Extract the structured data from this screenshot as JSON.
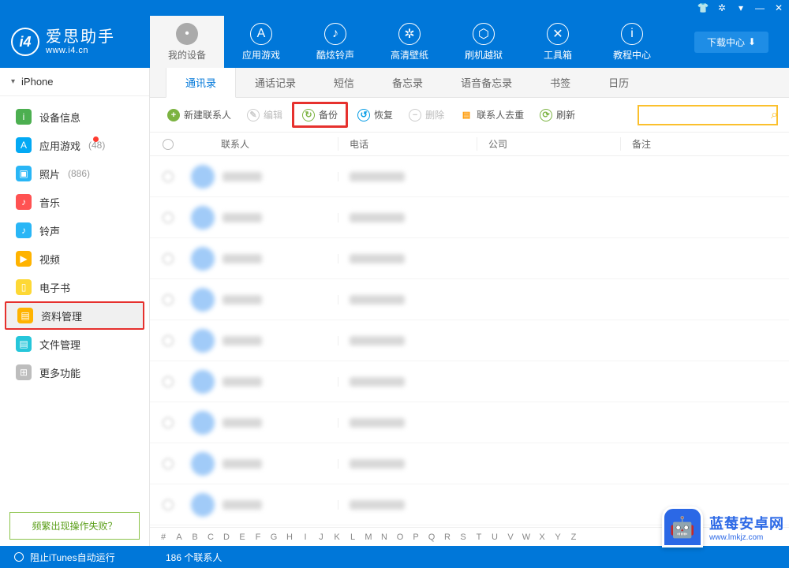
{
  "titlebar": {
    "icons": [
      "shirt",
      "gear",
      "dropdown",
      "min",
      "close"
    ]
  },
  "logo": {
    "badge": "i4",
    "cn": "爱思助手",
    "en": "www.i4.cn"
  },
  "nav": [
    {
      "label": "我的设备",
      "icon": "apple",
      "active": true
    },
    {
      "label": "应用游戏",
      "icon": "app"
    },
    {
      "label": "酷炫铃声",
      "icon": "bell"
    },
    {
      "label": "高清壁纸",
      "icon": "wall"
    },
    {
      "label": "刷机越狱",
      "icon": "box"
    },
    {
      "label": "工具箱",
      "icon": "tool"
    },
    {
      "label": "教程中心",
      "icon": "info"
    }
  ],
  "download_btn": "下载中心",
  "device_name": "iPhone",
  "sidebar": [
    {
      "label": "设备信息",
      "color": "#4caf50",
      "glyph": "i"
    },
    {
      "label": "应用游戏",
      "color": "#03a9f4",
      "glyph": "A",
      "count": "(48)",
      "dot": true
    },
    {
      "label": "照片",
      "color": "#29b6f6",
      "glyph": "▣",
      "count": "(886)"
    },
    {
      "label": "音乐",
      "color": "#ff5252",
      "glyph": "♪"
    },
    {
      "label": "铃声",
      "color": "#29b6f6",
      "glyph": "♪"
    },
    {
      "label": "视频",
      "color": "#ffb300",
      "glyph": "▶"
    },
    {
      "label": "电子书",
      "color": "#fdd835",
      "glyph": "▯"
    },
    {
      "label": "资料管理",
      "color": "#ffb300",
      "glyph": "▤",
      "highlighted": true
    },
    {
      "label": "文件管理",
      "color": "#26c6da",
      "glyph": "▤"
    },
    {
      "label": "更多功能",
      "color": "#bdbdbd",
      "glyph": "⊞"
    }
  ],
  "sidebar_help": "频繁出现操作失败？",
  "tabs": [
    {
      "label": "通讯录",
      "active": true
    },
    {
      "label": "通话记录"
    },
    {
      "label": "短信"
    },
    {
      "label": "备忘录"
    },
    {
      "label": "语音备忘录"
    },
    {
      "label": "书签"
    },
    {
      "label": "日历"
    }
  ],
  "toolbar": {
    "new_contact": "新建联系人",
    "edit": "编辑",
    "backup": "备份",
    "restore": "恢复",
    "delete": "删除",
    "dedupe": "联系人去重",
    "refresh": "刷新"
  },
  "columns": {
    "contact": "联系人",
    "phone": "电话",
    "company": "公司",
    "note": "备注"
  },
  "row_count": 9,
  "alphabet": [
    "#",
    "A",
    "B",
    "C",
    "D",
    "E",
    "F",
    "G",
    "H",
    "I",
    "J",
    "K",
    "L",
    "M",
    "N",
    "O",
    "P",
    "Q",
    "R",
    "S",
    "T",
    "U",
    "V",
    "W",
    "X",
    "Y",
    "Z"
  ],
  "statusbar": {
    "itunes": "阻止iTunes自动运行",
    "count": "186 个联系人"
  },
  "watermark": {
    "cn": "蓝莓安卓网",
    "en": "www.lmkjz.com"
  }
}
